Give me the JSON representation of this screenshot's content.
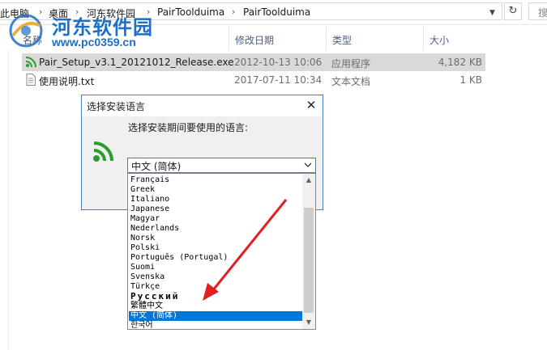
{
  "address": {
    "crumbs": [
      "此电脑",
      "桌面",
      "河东软件园",
      "PairToolduima",
      "PairToolduima"
    ],
    "search_placeholder": "搜"
  },
  "watermark": {
    "title": "河东软件园",
    "url": "www.pc0359.cn"
  },
  "columns": [
    "名称",
    "修改日期",
    "类型",
    "大小"
  ],
  "files": [
    {
      "name": "Pair_Setup_v3.1_20121012_Release.exe",
      "date": "2012-10-13 10:06",
      "type": "应用程序",
      "size": "4,182 KB",
      "icon": "wifi-app-icon"
    },
    {
      "name": "使用说明.txt",
      "date": "2017-07-11 10:34",
      "type": "文本文档",
      "size": "1 KB",
      "icon": "text-file-icon"
    }
  ],
  "dialog": {
    "title": "选择安装语言",
    "prompt": "选择安装期间要使用的语言:",
    "selected": "中文 (简体)",
    "close": "✕"
  },
  "languages": [
    "Français",
    "Greek",
    "Italiano",
    "Japanese",
    "Magyar",
    "Nederlands",
    "Norsk",
    "Polski",
    "Português (Portugal)",
    "Suomi",
    "Svenska",
    "Türkçe",
    "Русский",
    "繁體中文",
    "中文 (简体)",
    "한국어"
  ],
  "highlighted_index": 14,
  "colors": {
    "accent": "#0078d7",
    "annotation_arrow": "#e02020",
    "watermark": "#1e6fc8"
  }
}
